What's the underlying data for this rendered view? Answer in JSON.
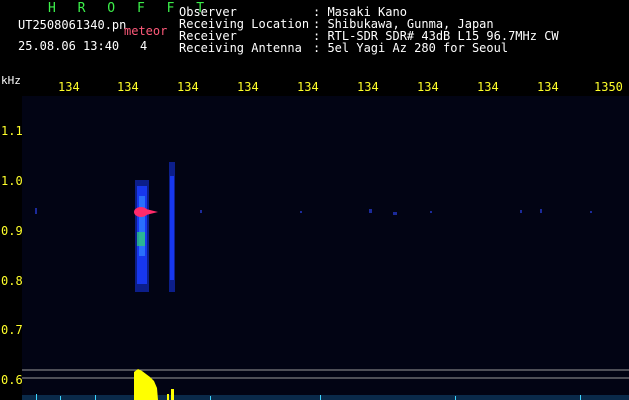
{
  "header": {
    "logo": "H R O F F T",
    "filename": "UT2508061340.pn",
    "meteor_label": "meteor",
    "datetime": "25.08.06 13:40",
    "meteor_count": "4",
    "info": [
      {
        "label": "Observer",
        "value": ": Masaki Kano"
      },
      {
        "label": "Receiving Location",
        "value": ": Shibukawa, Gunma, Japan"
      },
      {
        "label": "Receiver",
        "value": ": RTL-SDR SDR# 43dB L15 96.7MHz CW"
      },
      {
        "label": "Receiving Antenna",
        "value": ": 5el Yagi Az 280 for Seoul"
      }
    ]
  },
  "axis": {
    "y_unit": "kHz",
    "y_ticks": [
      "1.1",
      "1.0",
      "0.9",
      "0.8",
      "0.7",
      "0.6"
    ],
    "x_ticks": [
      "134",
      "134",
      "134",
      "134",
      "134",
      "134",
      "134",
      "134",
      "134",
      "1350"
    ]
  },
  "colors": {
    "background": "#000000",
    "text": "#ffffff",
    "accent_green": "#3cf04a",
    "tick_yellow": "#ffff2a",
    "signal_blue": "#1a3cff",
    "signal_core": "#ff2a6a"
  }
}
